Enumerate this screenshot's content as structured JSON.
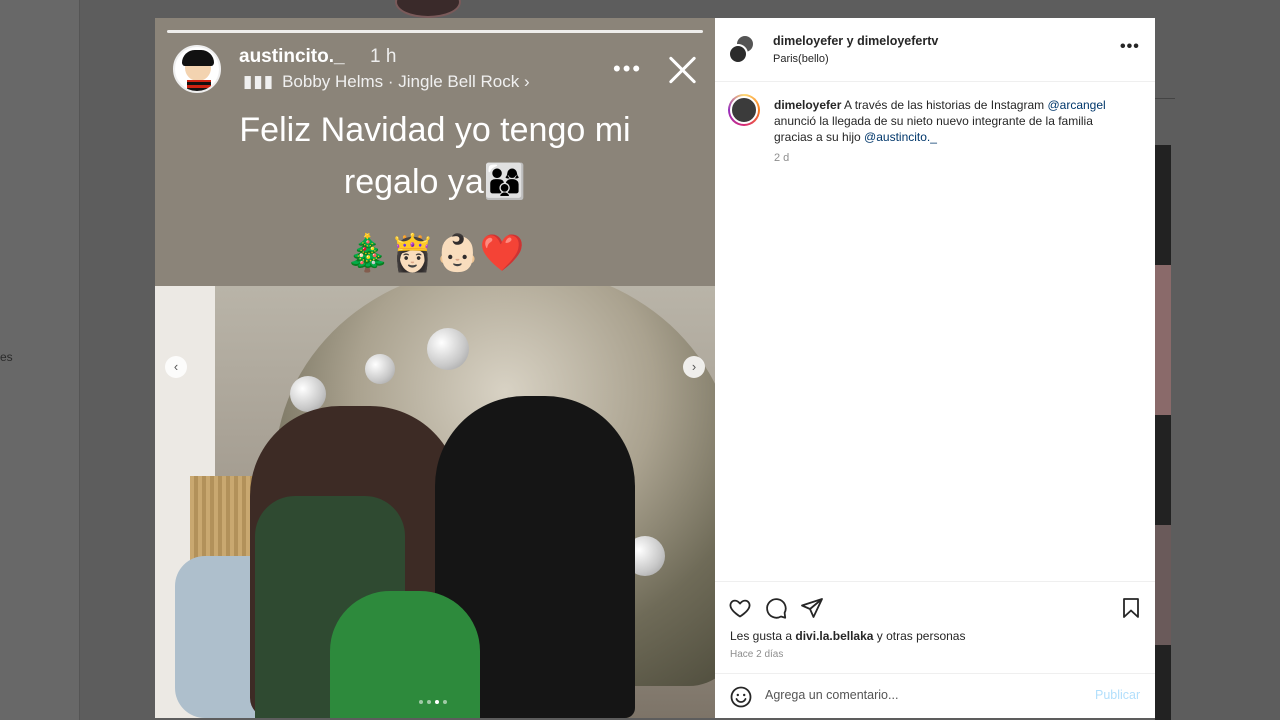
{
  "background": {
    "sidebar_fragment": "es"
  },
  "story": {
    "username": "austincito._",
    "time": "1 h",
    "song": "Bobby Helms · Jingle Bell Rock ›",
    "text": "Feliz Navidad yo tengo mi regalo ya👨‍👩‍👦",
    "emojis": "🎄👸🏻👶🏻❤️",
    "more_icon": "more-horizontal-icon",
    "close_icon": "close-icon"
  },
  "carousel": {
    "prev_icon": "chevron-left-icon",
    "next_icon": "chevron-right-icon",
    "slide_count": 4,
    "active_slide": 3
  },
  "post": {
    "header_names": "dimeloyefer y dimeloyefertv",
    "location": "Paris(bello)",
    "caption_user": "dimeloyefer",
    "caption_part1": " A través de las historias de Instagram ",
    "caption_mention1": "@arcangel",
    "caption_part2": " anunció la llegada de su nieto nuevo integrante de la familia gracias a su hijo ",
    "caption_mention2": "@austincito._",
    "caption_time": "2 d",
    "likes_prefix": "Les gusta a ",
    "likes_user": "divi.la.bellaka",
    "likes_suffix": " y otras personas",
    "posted_ago": "Hace 2 días",
    "comment_placeholder": "Agrega un comentario...",
    "publish_label": "Publicar",
    "colors": {
      "mention": "#00376b",
      "publish_disabled": "#b2dffc",
      "muted": "#8e8e8e"
    }
  }
}
